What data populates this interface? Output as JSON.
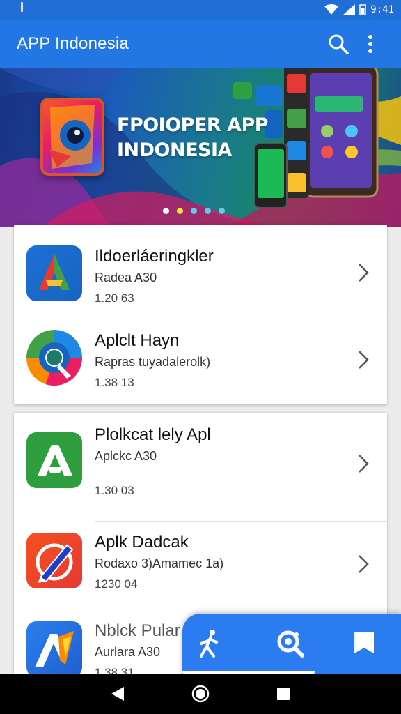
{
  "status_bar": {
    "time": "9:41"
  },
  "app_bar": {
    "title": "APP Indonesia",
    "actions": [
      "search-icon",
      "more-vert-icon"
    ]
  },
  "banner": {
    "title_line1": "FPOIOPER APP",
    "title_line2": "INDONESIA",
    "page_count": 5,
    "active_page": 0
  },
  "apps": [
    {
      "name": "Ildoerláeringkler",
      "sub": "Radea A30",
      "meta": "1.20 63",
      "icon": "letter-a-icon",
      "icon_colors": [
        "#1f6fd6",
        "#e53935",
        "#43a047",
        "#fbc02d"
      ]
    },
    {
      "name": "Aplclt Hayn",
      "sub": "Rapras tuyadalerolk)",
      "meta": "1.38 13",
      "icon": "letter-q-icon",
      "icon_colors": [
        "#1e88e5",
        "#e91e63",
        "#fb8c00",
        "#43a047"
      ]
    },
    {
      "name": "Plolkcat lely Apl",
      "sub": "Aplckc A30",
      "meta": "1.30 03",
      "icon": "letter-a-green-icon",
      "icon_colors": [
        "#2e9e3f"
      ]
    },
    {
      "name": "Aplk Dadcak",
      "sub": "Rodaxo 3)Amamec 1a)",
      "meta": "1230 04",
      "icon": "pen-app-icon",
      "icon_colors": [
        "#f4511e",
        "#1e40c8"
      ]
    },
    {
      "name": "Nblck Pular",
      "sub": "Aurlara A30",
      "meta": "1.38 31",
      "icon": "letter-a-blue-icon",
      "icon_colors": [
        "#1f6fd6",
        "#fb8c00"
      ]
    }
  ],
  "bottom_nav": [
    "person-run-icon",
    "search-refresh-icon",
    "bookmark-icon"
  ],
  "system_nav": [
    "back-icon",
    "home-icon",
    "recents-icon"
  ]
}
